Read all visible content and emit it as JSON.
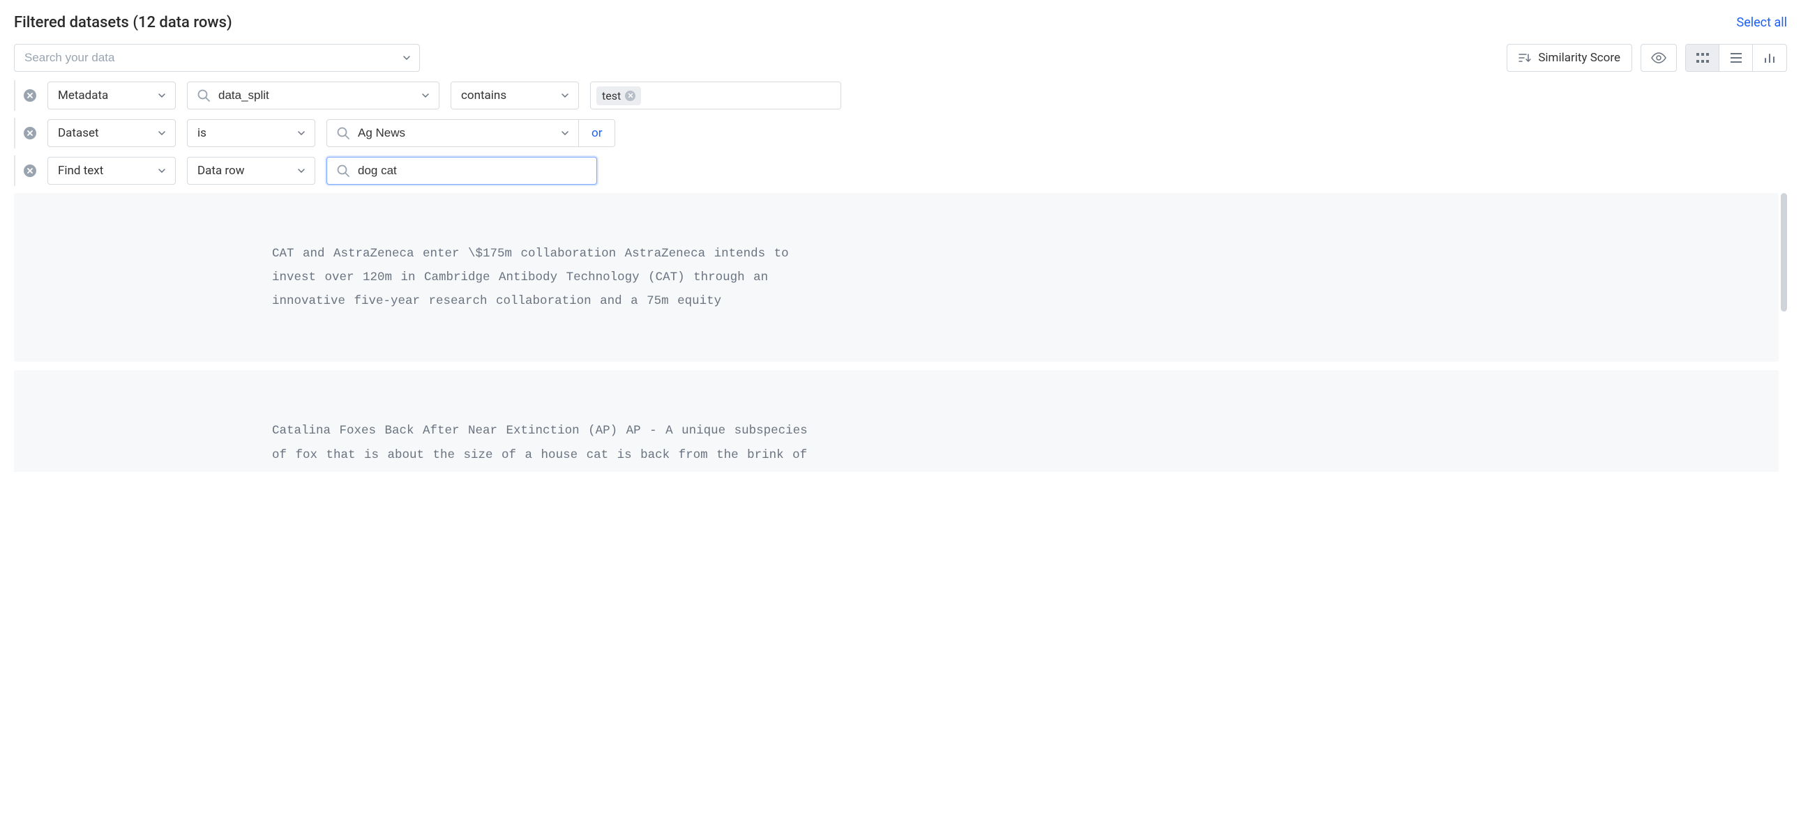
{
  "header": {
    "title": "Filtered datasets (12 data rows)",
    "select_all": "Select all"
  },
  "search": {
    "placeholder": "Search your data"
  },
  "toolbar": {
    "similarity_label": "Similarity Score"
  },
  "filters": [
    {
      "type_label": "Metadata",
      "field_value": "data_split",
      "operator_label": "contains",
      "chips": [
        "test"
      ]
    },
    {
      "type_label": "Dataset",
      "operator_label": "is",
      "field_value": "Ag News",
      "or_label": "or"
    },
    {
      "type_label": "Find text",
      "scope_label": "Data row",
      "query_value": "dog cat"
    }
  ],
  "results": [
    {
      "text": "CAT and AstraZeneca enter \\$175m collaboration AstraZeneca intends to invest over 120m in Cambridge Antibody Technology (CAT) through an innovative five-year research collaboration and a 75m equity"
    },
    {
      "text": "Catalina Foxes Back After Near Extinction (AP) AP - A unique subspecies of fox that is about the size of a house cat is back from the brink of extinction on Santa Catalina Island and can survive on its own thanks to a captive breeding program, the head of a nonprofit group that manages"
    }
  ]
}
